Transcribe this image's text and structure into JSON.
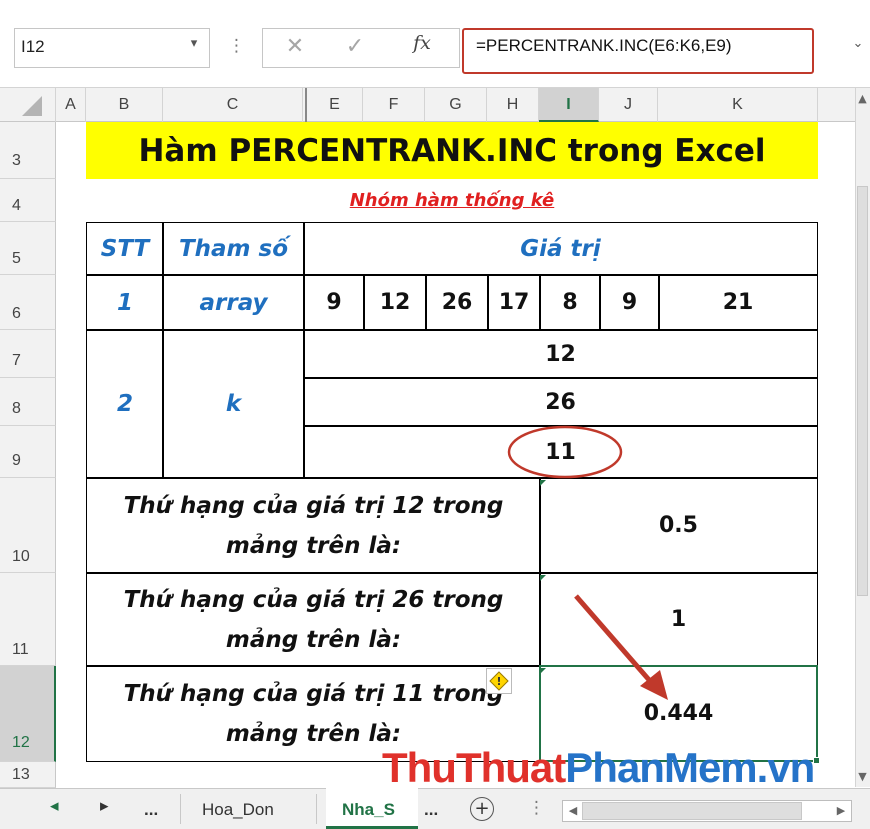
{
  "formula_bar": {
    "name_box": "I12",
    "cancel_symbol": "✕",
    "enter_symbol": "✓",
    "fx_label": "fx",
    "formula": "=PERCENTRANK.INC(E6:K6,E9)"
  },
  "columns": [
    "A",
    "B",
    "C",
    "E",
    "F",
    "G",
    "H",
    "I",
    "J",
    "K"
  ],
  "rows": [
    "3",
    "4",
    "5",
    "6",
    "7",
    "8",
    "9",
    "10",
    "11",
    "12",
    "13"
  ],
  "selected": {
    "column": "I",
    "row": "12"
  },
  "sheet": {
    "title": "Hàm PERCENTRANK.INC trong Excel",
    "subtitle": "Nhóm hàm thống kê",
    "header": {
      "stt": "STT",
      "param": "Tham số",
      "value": "Giá trị"
    },
    "array_row": {
      "stt": "1",
      "param": "array",
      "values": [
        "9",
        "12",
        "26",
        "17",
        "8",
        "9",
        "21"
      ]
    },
    "k_rows": {
      "stt": "2",
      "param": "k",
      "values": [
        "12",
        "26",
        "11"
      ]
    },
    "results": [
      {
        "line1": "Thứ hạng của giá trị 12 trong",
        "line2": "mảng trên là:",
        "value": "0.5"
      },
      {
        "line1": "Thứ hạng của giá trị 26 trong",
        "line2": "mảng trên là:",
        "value": "1"
      },
      {
        "line1": "Thứ hạng của giá trị 11 trong",
        "line2": "mảng trên là:",
        "value": "0.444"
      }
    ]
  },
  "tabs": {
    "prev": "◂",
    "next": "▸",
    "more_left": "...",
    "sheet1": "Hoa_Don",
    "sheet2": "Nha_S",
    "more_right": "...",
    "add": "+"
  },
  "watermark": {
    "part1": "Thu",
    "part2": "Thuat",
    "part3": "PhanMem",
    "part4": ".vn"
  },
  "colors": {
    "excel_green": "#217346",
    "title_fill": "#ffff00",
    "accent_red": "#c0392b",
    "header_blue": "#1f6fbf"
  }
}
